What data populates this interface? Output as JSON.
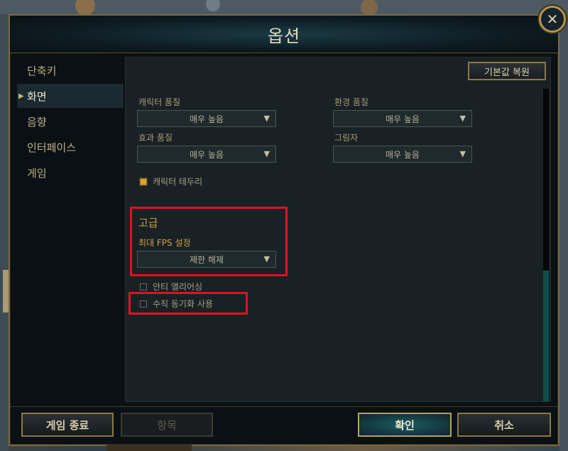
{
  "dialog": {
    "title": "옵션",
    "close_icon": "close-icon"
  },
  "sidebar": {
    "items": [
      {
        "label": "단축키",
        "active": false
      },
      {
        "label": "화면",
        "active": true
      },
      {
        "label": "음향",
        "active": false
      },
      {
        "label": "인터페이스",
        "active": false
      },
      {
        "label": "게임",
        "active": false
      }
    ]
  },
  "panel": {
    "reset_label": "기본값 복원",
    "character_quality": {
      "label": "캐릭터 품질",
      "value": "매우 높음"
    },
    "environment_quality": {
      "label": "환경 품질",
      "value": "매우 높음"
    },
    "effect_quality": {
      "label": "효과 품질",
      "value": "매우 높음"
    },
    "shadow": {
      "label": "그림자",
      "value": "매우 높음"
    },
    "character_outline": {
      "label": "캐릭터 테두리",
      "checked": true
    },
    "advanced": {
      "title": "고급",
      "fps_label": "최대 FPS 설정",
      "fps_value": "제한 해제"
    },
    "anti_aliasing": {
      "label": "안티 앨리어싱",
      "checked": false
    },
    "vsync": {
      "label": "수직 동기화 사용",
      "checked": false
    }
  },
  "footer": {
    "exit_label": "게임 종료",
    "item_label": "항목",
    "ok_label": "확인",
    "cancel_label": "취소"
  },
  "colors": {
    "accent_gold": "#c9a243",
    "highlight_red": "#e0121f",
    "teal_primary": "#1d5c64"
  }
}
